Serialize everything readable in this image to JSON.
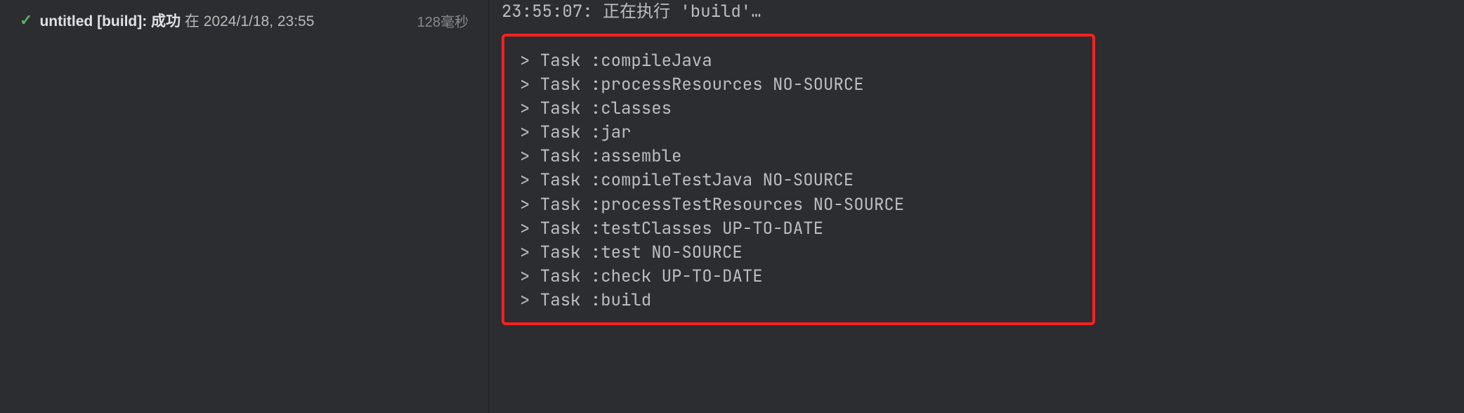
{
  "build": {
    "title": "untitled [build]:",
    "status": "成功",
    "timestamp_prefix": "在",
    "timestamp": "2024/1/18, 23:55",
    "duration": "128毫秒"
  },
  "console": {
    "header": "23:55:07: 正在执行 'build'…",
    "tasks": [
      "> Task :compileJava",
      "> Task :processResources NO-SOURCE",
      "> Task :classes",
      "> Task :jar",
      "> Task :assemble",
      "> Task :compileTestJava NO-SOURCE",
      "> Task :processTestResources NO-SOURCE",
      "> Task :testClasses UP-TO-DATE",
      "> Task :test NO-SOURCE",
      "> Task :check UP-TO-DATE",
      "> Task :build"
    ]
  }
}
